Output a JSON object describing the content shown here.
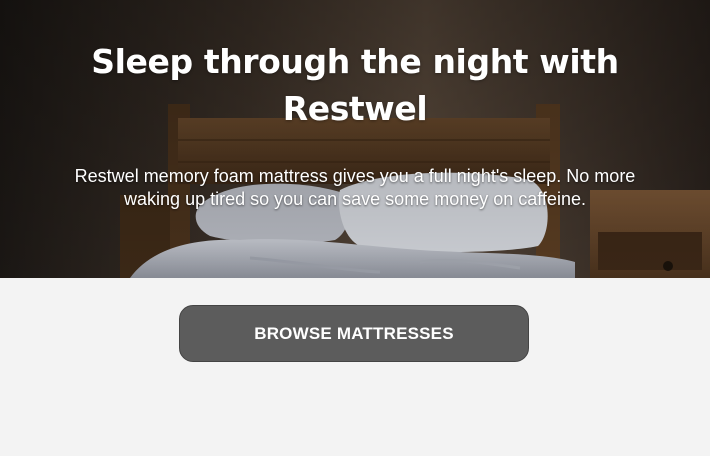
{
  "hero": {
    "title": "Sleep through the night with Restwel",
    "subtitle": "Restwel memory foam mattress gives you a full night's sleep. No more waking up tired so you can save some money on caffeine.",
    "image": "bedroom-photo"
  },
  "cta": {
    "label": "BROWSE MATTRESSES"
  },
  "colors": {
    "page_background": "#f3f3f3",
    "button_background": "#5c5c5c",
    "button_text": "#ffffff",
    "hero_text": "#ffffff"
  }
}
